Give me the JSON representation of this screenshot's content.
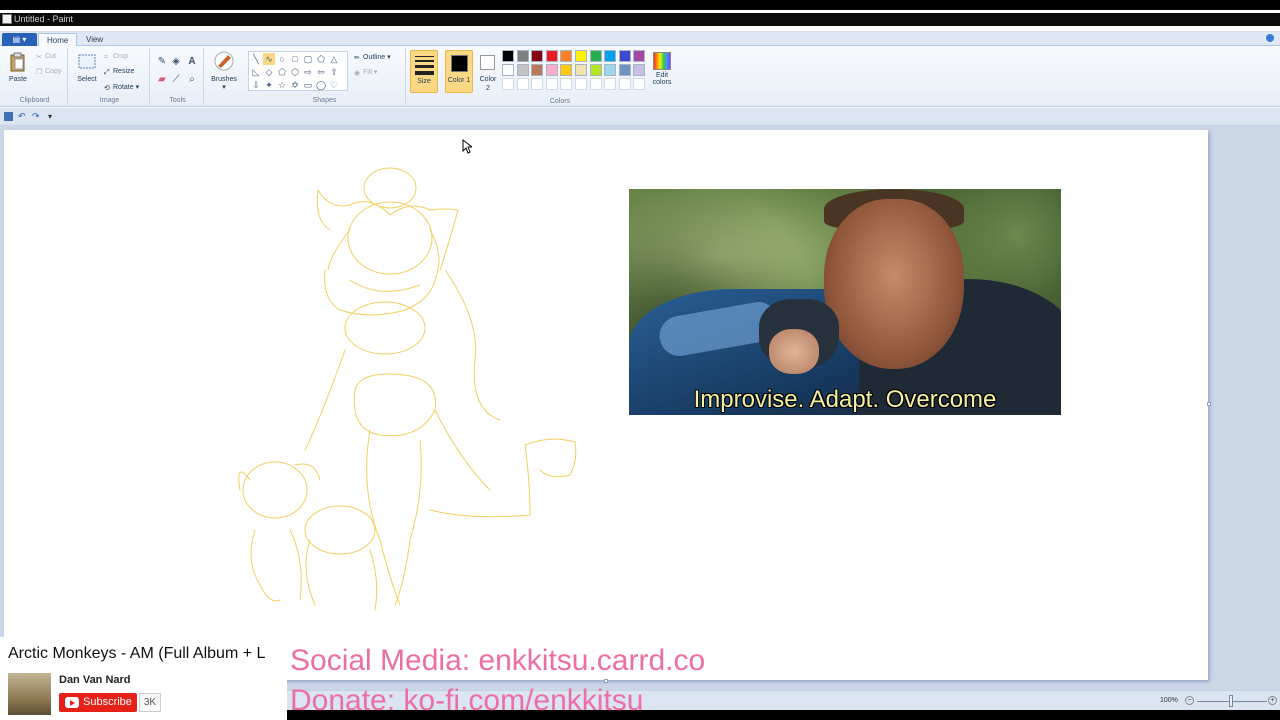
{
  "window": {
    "title": "Untitled - Paint"
  },
  "tabs": {
    "home": "Home",
    "view": "View"
  },
  "clipboard": {
    "paste": "Paste",
    "cut": "Cut",
    "copy": "Copy",
    "label": "Clipboard"
  },
  "image": {
    "select": "Select",
    "crop": "Crop",
    "resize": "Resize",
    "rotate": "Rotate",
    "label": "Image"
  },
  "tools": {
    "label": "Tools",
    "brushes": "Brushes"
  },
  "shapes": {
    "outline": "Outline",
    "fill": "Fill",
    "label": "Shapes"
  },
  "size": {
    "label": "Size"
  },
  "colors": {
    "color1": "Color 1",
    "color2": "Color 2",
    "edit": "Edit colors",
    "label": "Colors",
    "palette_row1": [
      "#000000",
      "#7f7f7f",
      "#880015",
      "#ed1c24",
      "#ff7f27",
      "#fff200",
      "#22b14c",
      "#00a2e8",
      "#3f48cc",
      "#a349a4"
    ],
    "palette_row2": [
      "#ffffff",
      "#c3c3c3",
      "#b97a57",
      "#ffaec9",
      "#ffc90e",
      "#efe4b0",
      "#b5e61d",
      "#99d9ea",
      "#7092be",
      "#c8bfe7"
    ]
  },
  "canvas": {
    "meme_caption": "Improvise. Adapt. Overcome",
    "sketch_color": "#f0d060"
  },
  "status": {
    "zoom": "100%"
  },
  "youtube": {
    "title": "Arctic Monkeys - AM (Full Album + L",
    "channel": "Dan Van Nard",
    "subscribe": "Subscribe",
    "count": "3K"
  },
  "overlay": {
    "social": "Social Media: enkkitsu.carrd.co",
    "donate": "Donate: ko-fi.com/enkkitsu"
  }
}
